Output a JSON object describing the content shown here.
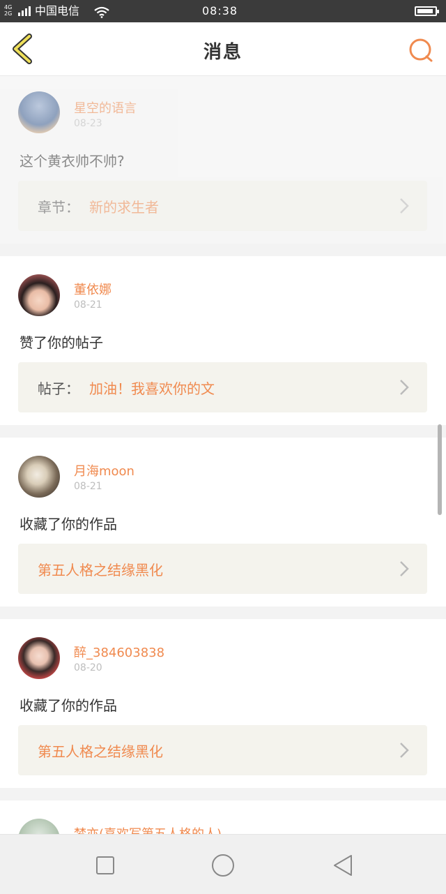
{
  "status_bar": {
    "network": "4G",
    "network2": "2G",
    "carrier": "中国电信",
    "time": "08:38",
    "icons": [
      "signal-icon",
      "wifi-icon",
      "battery-icon"
    ]
  },
  "header": {
    "title": "消息",
    "back_icon": "chevron-left-icon",
    "search_icon": "search-icon"
  },
  "colors": {
    "accent": "#f08a4f",
    "back_arrow": "#e8d44a",
    "ref_background": "#f4f3ed"
  },
  "messages": [
    {
      "username": "星空的语言",
      "date": "08-23",
      "action": "这个黄衣帅不帅?",
      "ref_label": "章节：",
      "ref_value": "新的求生者"
    },
    {
      "username": "董依娜",
      "date": "08-21",
      "action": "赞了你的帖子",
      "ref_label": "帖子：",
      "ref_value": "加油！我喜欢你的文"
    },
    {
      "username": "月海moon",
      "date": "08-21",
      "action": "收藏了你的作品",
      "ref_label": "",
      "ref_value": "第五人格之结缘黑化"
    },
    {
      "username": "醉_384603838",
      "date": "08-20",
      "action": "收藏了你的作品",
      "ref_label": "",
      "ref_value": "第五人格之结缘黑化"
    },
    {
      "username": "梦亦(喜欢写第五人格的人)",
      "date": "",
      "action": "",
      "ref_label": "",
      "ref_value": ""
    }
  ],
  "nav_bar": {
    "icons": [
      "square-icon",
      "circle-home-icon",
      "triangle-back-icon"
    ]
  }
}
